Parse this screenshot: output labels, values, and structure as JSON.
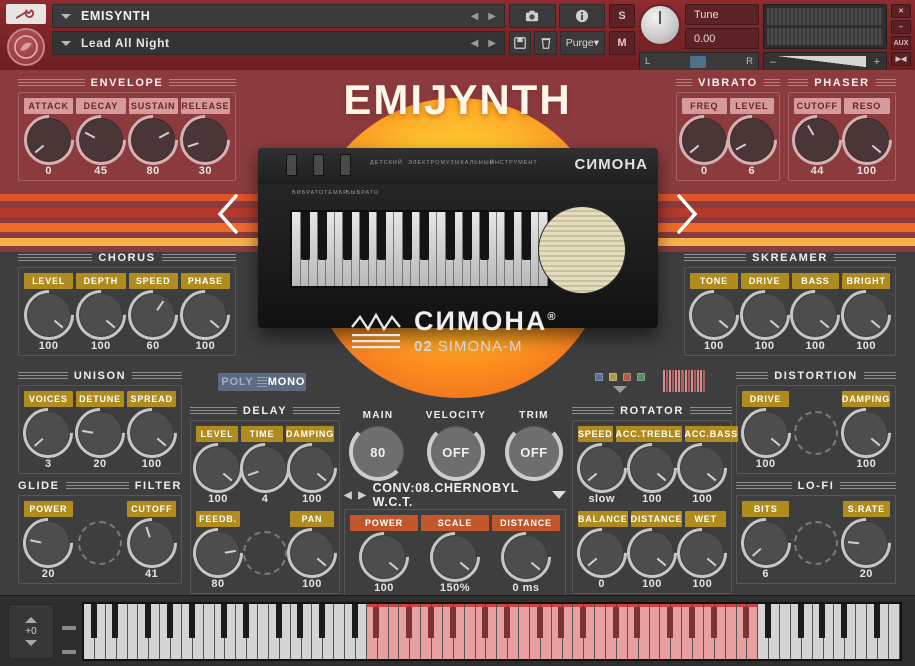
{
  "header": {
    "instrument_name": "EMISYNTH",
    "preset_name": "Lead All Night",
    "wrench_icon": "wrench-icon",
    "logo_icon": "kontakt-logo-icon",
    "prev_icon": "prev-arrow-icon",
    "next_icon": "next-arrow-icon",
    "snapshot_icon": "camera-icon",
    "info_icon": "info-icon",
    "save_icon": "save-icon",
    "trash_icon": "trash-icon",
    "purge_label": "Purge",
    "solo_label": "S",
    "mute_label": "M",
    "tune_label": "Tune",
    "tune_value": "0.00",
    "pan_left": "L",
    "pan_right": "R",
    "vol_minus": "–",
    "vol_plus": "+",
    "side_buttons": [
      "✕",
      "–",
      "AUX",
      "▶◀"
    ]
  },
  "brand": {
    "title": "EMIJYNTH",
    "instrument_label_cyr": "СИМОНА",
    "instrument_caption_1": "ДЕТСКИЙ",
    "instrument_caption_2": "ЭЛЕКТРОМУЗЫКАЛЬНЫЙ",
    "instrument_caption_3": "ИНСТРУМЕНТ",
    "sw_labels": [
      "ВИБРАТО",
      "ТЕМБР",
      "ВЫВРАТО"
    ],
    "center_logo_cyr": "СИМОНА",
    "center_logo_reg": "®",
    "center_logo_sub_num": "02",
    "center_logo_sub_name": "SIMONA-M",
    "nav_left_icon": "chevron-left-icon",
    "nav_right_icon": "chevron-right-icon"
  },
  "modules": {
    "envelope": {
      "title": "ENVELOPE",
      "style": "pink",
      "labels": [
        "ATTACK",
        "DECAY",
        "SUSTAIN",
        "RELEASE"
      ],
      "values": [
        "0",
        "45",
        "80",
        "30"
      ],
      "angles": [
        -130,
        -62,
        62,
        -108
      ]
    },
    "vibrato": {
      "title": "VIBRATO",
      "style": "pink",
      "labels": [
        "FREQ",
        "LEVEL"
      ],
      "values": [
        "0",
        "6"
      ],
      "angles": [
        -130,
        -118
      ]
    },
    "phaser": {
      "title": "PHASER",
      "style": "pink",
      "labels": [
        "CUTOFF",
        "RESO"
      ],
      "values": [
        "44",
        "100"
      ],
      "angles": [
        -30,
        130
      ]
    },
    "chorus": {
      "title": "CHORUS",
      "style": "gold",
      "labels": [
        "LEVEL",
        "DEPTH",
        "SPEED",
        "PHASE"
      ],
      "values": [
        "100",
        "100",
        "60",
        "100"
      ],
      "angles": [
        130,
        130,
        35,
        130
      ]
    },
    "skreamer": {
      "title": "SKREAMER",
      "style": "gold",
      "labels": [
        "TONE",
        "DRIVE",
        "BASS",
        "BRIGHT"
      ],
      "values": [
        "100",
        "100",
        "100",
        "100"
      ],
      "angles": [
        130,
        130,
        130,
        130
      ]
    },
    "unison": {
      "title": "UNISON",
      "style": "gold",
      "labels": [
        "VOICES",
        "DETUNE",
        "SPREAD"
      ],
      "values": [
        "3",
        "20",
        "100"
      ],
      "angles": [
        -132,
        -80,
        130
      ]
    },
    "glide_filter": {
      "title_left": "GLIDE",
      "title_right": "FILTER",
      "style": "gold",
      "labels": [
        "POWER",
        "",
        "CUTOFF"
      ],
      "values": [
        "20",
        "",
        "41"
      ],
      "angles": [
        -78,
        0,
        -18
      ]
    },
    "delay": {
      "title": "DELAY",
      "style": "gold",
      "labels_row1": [
        "LEVEL",
        "TIME",
        "DAMPING"
      ],
      "values_row1": [
        "100",
        "4",
        "100"
      ],
      "angles_row1": [
        130,
        -110,
        130
      ],
      "labels_row2": [
        "FEEDB.",
        "",
        "PAN"
      ],
      "values_row2": [
        "80",
        "",
        "100"
      ],
      "angles_row2": [
        80,
        0,
        130
      ]
    },
    "rotator": {
      "title": "ROTATOR",
      "style": "gold",
      "labels_row1": [
        "SPEED",
        "ACC.TREBLE",
        "ACC.BASS"
      ],
      "values_row1": [
        "slow",
        "100",
        "100"
      ],
      "angles_row1": [
        -130,
        130,
        130
      ],
      "labels_row2": [
        "BALANCE",
        "DISTANCE",
        "WET"
      ],
      "values_row2": [
        "0",
        "100",
        "100"
      ],
      "angles_row2": [
        -130,
        130,
        130
      ]
    },
    "distortion": {
      "title": "DISTORTION",
      "style": "gold",
      "labels": [
        "DRIVE",
        "",
        "DAMPING"
      ],
      "values": [
        "100",
        "",
        "100"
      ],
      "angles": [
        130,
        0,
        130
      ]
    },
    "lofi": {
      "title": "LO-FI",
      "style": "gold",
      "labels": [
        "BITS",
        "",
        "S.RATE"
      ],
      "values": [
        "6",
        "",
        "20"
      ],
      "angles": [
        -132,
        0,
        -84
      ]
    },
    "convolution": {
      "prev_icon": "conv-prev-icon",
      "next_icon": "conv-next-icon",
      "name": "CONV:08.CHERNOBYL W.C.T.",
      "dropdown_icon": "chevron-down-icon",
      "labels": [
        "POWER",
        "SCALE",
        "DISTANCE"
      ],
      "values": [
        "100",
        "150%",
        "0 ms"
      ],
      "angles": [
        130,
        130,
        130
      ]
    },
    "output": {
      "main_label": "MAIN",
      "main_value": "80",
      "velocity_label": "VELOCITY",
      "velocity_value": "OFF",
      "trim_label": "TRIM",
      "trim_value": "OFF"
    }
  },
  "voice_mode": {
    "poly_label": "POLY",
    "mono_label": "MONO",
    "selected": "MONO"
  },
  "indicators": {
    "dots": [
      "#5a6f99",
      "#b09a4a",
      "#b55a4a",
      "#5a8a5a"
    ],
    "caret_icon": "chevron-down-icon",
    "mini_keyboard_icon": "mini-keyboard-icon"
  },
  "keyboard": {
    "octave_value": "+0",
    "up_icon": "arrow-up-icon",
    "down_icon": "arrow-down-icon"
  },
  "colors": {
    "gold": "#b08b1e",
    "orange": "#c0562a",
    "pink": "#d49a9c",
    "panel": "#3e3e3e",
    "red_header": "#8e2c2f",
    "red_body": "#8b3b3e"
  }
}
